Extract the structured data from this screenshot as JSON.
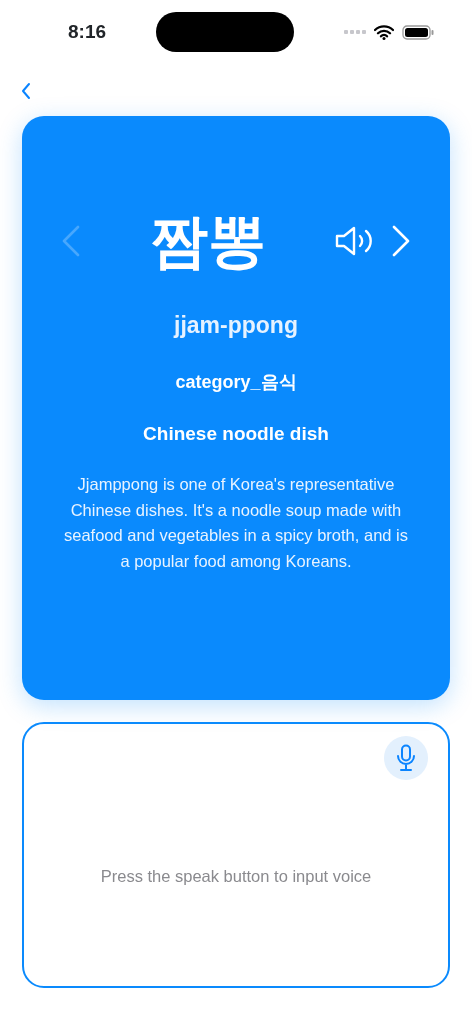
{
  "status_bar": {
    "time": "8:16"
  },
  "card": {
    "word": "짬뽕",
    "romanization": "jjam-ppong",
    "category": "category_음식",
    "meaning": "Chinese noodle dish",
    "description": "Jjamppong is one of Korea's representative Chinese dishes. It's a noodle soup made with seafood and vegetables in a spicy broth, and is a popular food among Koreans.",
    "previous": {
      "disabled": true
    },
    "next": {
      "disabled": false
    }
  },
  "voice_panel": {
    "hint": "Press the speak button to input voice"
  }
}
